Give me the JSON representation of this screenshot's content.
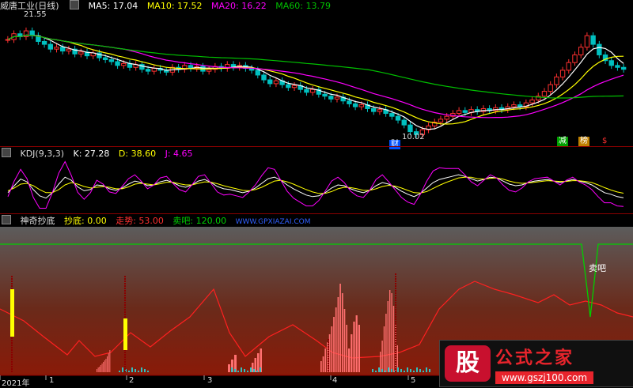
{
  "price_panel": {
    "title": "威唐工业(日线)",
    "ma5": "MA5: 17.04",
    "ma10": "MA10: 17.52",
    "ma20": "MA20: 16.22",
    "ma60": "MA60: 13.79",
    "high_label": "21.55",
    "low_label": "10.02",
    "badges": [
      "财",
      "减",
      "榜",
      "$"
    ],
    "colors": {
      "ma5": "#ffffff",
      "ma10": "#ffff00",
      "ma20": "#ff00ff",
      "ma60": "#00c000",
      "up": "#ff3030",
      "down": "#00c0c0"
    }
  },
  "kdj_panel": {
    "title": "KDJ(9,3,3)",
    "k": "K: 27.28",
    "d": "D: 38.60",
    "j": "J: 4.65"
  },
  "indicator_panel": {
    "title": "神奇抄底",
    "bottom_label": "抄底: 0.00",
    "trend_label": "走势: 53.00",
    "sell_label": "卖吧: 120.00",
    "site": "WWW.GPXIAZAI.COM",
    "sell_annotation": "卖吧"
  },
  "x_axis": {
    "labels": [
      "2021年",
      "1",
      "2",
      "3",
      "4",
      "5"
    ]
  },
  "watermark": {
    "logo": "股",
    "title": "公式之家",
    "url": "www.gszj100.com"
  },
  "chart_data": [
    {
      "type": "line",
      "title": "威唐工业(日线)",
      "series": [
        {
          "name": "MA5",
          "last": 17.04
        },
        {
          "name": "MA10",
          "last": 17.52
        },
        {
          "name": "MA20",
          "last": 16.22
        },
        {
          "name": "MA60",
          "last": 13.79
        }
      ],
      "annotations": [
        {
          "text": "21.55",
          "kind": "high"
        },
        {
          "text": "10.02",
          "kind": "low"
        }
      ],
      "close": [
        20.2,
        20.8,
        20.5,
        21.1,
        20.6,
        20.0,
        19.7,
        19.2,
        19.4,
        19.0,
        19.2,
        18.7,
        18.9,
        18.5,
        18.8,
        18.3,
        18.1,
        17.9,
        17.5,
        17.7,
        17.3,
        17.6,
        17.1,
        16.9,
        17.2,
        17.0,
        16.8,
        17.3,
        17.1,
        17.5,
        17.2,
        17.4,
        16.9,
        17.1,
        17.4,
        17.2,
        17.6,
        17.3,
        17.5,
        17.2,
        17.0,
        16.5,
        16.0,
        15.6,
        15.9,
        15.5,
        15.2,
        15.4,
        15.0,
        14.7,
        15.0,
        14.5,
        14.3,
        14.0,
        14.2,
        13.8,
        13.5,
        13.2,
        13.4,
        13.0,
        12.7,
        12.9,
        12.5,
        12.2,
        11.8,
        11.3,
        10.6,
        10.3,
        10.8,
        11.2,
        11.6,
        11.9,
        12.2,
        12.5,
        12.8,
        12.6,
        12.9,
        12.7,
        13.0,
        12.8,
        13.1,
        12.9,
        13.2,
        13.4,
        13.2,
        13.6,
        13.9,
        14.3,
        14.8,
        15.5,
        16.3,
        17.0,
        17.8,
        18.6,
        19.4,
        20.6,
        19.7,
        18.6,
        18.0,
        17.5,
        17.3,
        17.1
      ]
    },
    {
      "type": "line",
      "title": "KDJ(9,3,3)",
      "series": [
        {
          "name": "K",
          "last": 27.28,
          "values": [
            40,
            58,
            75,
            68,
            48,
            32,
            26,
            40,
            62,
            80,
            72,
            55,
            45,
            48,
            60,
            58,
            50,
            46,
            52,
            62,
            70,
            66,
            58,
            60,
            68,
            72,
            66,
            58,
            54,
            60,
            70,
            74,
            66,
            56,
            50,
            48,
            44,
            40,
            44,
            52,
            64,
            76,
            80,
            72,
            60,
            50,
            42,
            34,
            30,
            32,
            40,
            52,
            60,
            58,
            50,
            44,
            40,
            46,
            58,
            66,
            62,
            54,
            44,
            36,
            30,
            38,
            52,
            66,
            74,
            78,
            82,
            86,
            82,
            76,
            70,
            74,
            80,
            78,
            70,
            62,
            58,
            60,
            66,
            70,
            72,
            74,
            70,
            66,
            70,
            74,
            70,
            66,
            60,
            50,
            40,
            36,
            30,
            27
          ]
        },
        {
          "name": "D",
          "last": 38.6,
          "values": [
            45,
            52,
            62,
            64,
            58,
            48,
            40,
            40,
            48,
            60,
            66,
            62,
            56,
            52,
            54,
            56,
            54,
            50,
            50,
            55,
            62,
            64,
            62,
            60,
            63,
            67,
            67,
            63,
            60,
            60,
            64,
            68,
            67,
            63,
            58,
            54,
            50,
            46,
            45,
            48,
            54,
            62,
            70,
            72,
            68,
            62,
            55,
            48,
            42,
            38,
            38,
            43,
            50,
            54,
            53,
            50,
            46,
            46,
            50,
            56,
            59,
            57,
            52,
            46,
            40,
            39,
            43,
            51,
            59,
            66,
            72,
            78,
            80,
            80,
            76,
            75,
            77,
            78,
            75,
            70,
            66,
            64,
            65,
            67,
            69,
            71,
            70,
            69,
            69,
            71,
            71,
            69,
            66,
            60,
            53,
            47,
            42,
            38.6
          ]
        },
        {
          "name": "J",
          "last": 4.65,
          "values": [
            30,
            70,
            100,
            76,
            28,
            0,
            0,
            40,
            90,
            120,
            84,
            41,
            23,
            40,
            72,
            62,
            42,
            38,
            56,
            76,
            86,
            70,
            50,
            60,
            78,
            82,
            64,
            48,
            42,
            60,
            82,
            86,
            64,
            42,
            34,
            36,
            32,
            28,
            42,
            60,
            84,
            104,
            100,
            72,
            44,
            26,
            16,
            6,
            6,
            20,
            44,
            70,
            80,
            66,
            44,
            32,
            28,
            46,
            74,
            86,
            68,
            48,
            28,
            16,
            10,
            36,
            70,
            96,
            104,
            102,
            102,
            102,
            86,
            68,
            58,
            72,
            86,
            78,
            60,
            46,
            42,
            52,
            68,
            76,
            78,
            80,
            70,
            60,
            72,
            80,
            68,
            60,
            48,
            30,
            14,
            14,
            6,
            4.65
          ]
        }
      ]
    },
    {
      "type": "bar",
      "title": "神奇抄底",
      "series": [
        {
          "name": "抄底",
          "last": 0.0
        },
        {
          "name": "走势",
          "last": 53.0
        },
        {
          "name": "卖吧",
          "last": 120.0
        }
      ],
      "annotations": [
        {
          "text": "卖吧"
        }
      ]
    }
  ]
}
